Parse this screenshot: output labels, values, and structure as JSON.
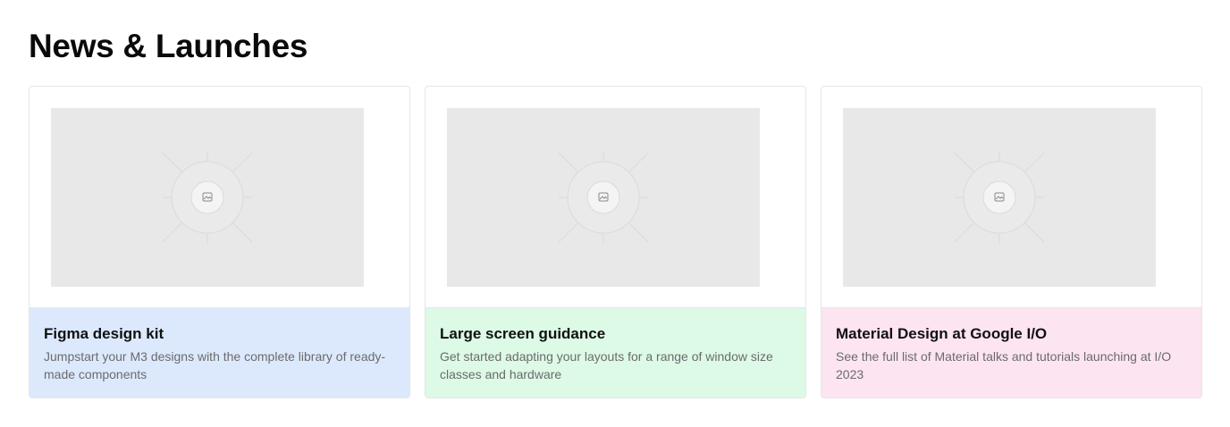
{
  "section": {
    "title": "News & Launches"
  },
  "cards": [
    {
      "title": "Figma design kit",
      "description": "Jumpstart your M3 designs with the complete library of ready-made components",
      "accent_color": "#dce9fd",
      "media_icon": "image-placeholder-icon"
    },
    {
      "title": "Large screen guidance",
      "description": "Get started adapting your layouts for a range of window size classes and hardware",
      "accent_color": "#dcfae6",
      "media_icon": "image-placeholder-icon"
    },
    {
      "title": "Material Design at Google I/O",
      "description": "See the full list of Material talks and tutorials launching at I/O 2023",
      "accent_color": "#fce4f1",
      "media_icon": "image-placeholder-icon"
    }
  ]
}
